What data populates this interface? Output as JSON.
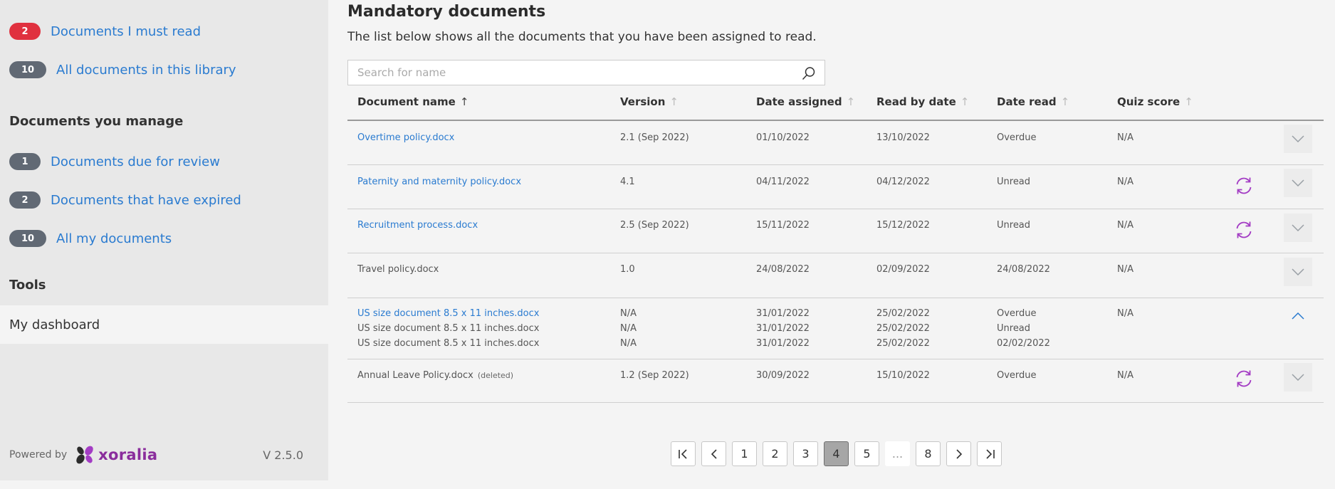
{
  "sidebar": {
    "must_read": {
      "count": "2",
      "label": "Documents I must read"
    },
    "all_library": {
      "count": "10",
      "label": "All documents in this library"
    },
    "manage_title": "Documents you manage",
    "due_review": {
      "count": "1",
      "label": "Documents due for review"
    },
    "expired": {
      "count": "2",
      "label": "Documents that have expired"
    },
    "all_mine": {
      "count": "10",
      "label": "All my documents"
    },
    "tools_title": "Tools",
    "dashboard": "My dashboard",
    "powered_by": "Powered by",
    "brand": "xoralia",
    "version": "V 2.5.0"
  },
  "main": {
    "title": "Mandatory documents",
    "description": "The list below shows all the documents that you have been assigned to read.",
    "search_placeholder": "Search for name",
    "columns": {
      "name": "Document name",
      "version": "Version",
      "date_assigned": "Date assigned",
      "read_by": "Read by date",
      "date_read": "Date read",
      "quiz": "Quiz score"
    },
    "rows": [
      {
        "name": "Overtime policy.docx",
        "version": "2.1 (Sep 2022)",
        "assigned": "01/10/2022",
        "read_by": "13/10/2022",
        "date_read": "Overdue",
        "quiz": "N/A"
      },
      {
        "name": "Paternity and maternity policy.docx",
        "version": "4.1",
        "assigned": "04/11/2022",
        "read_by": "04/12/2022",
        "date_read": "Unread",
        "quiz": "N/A"
      },
      {
        "name": "Recruitment process.docx",
        "version": "2.5 (Sep 2022)",
        "assigned": "15/11/2022",
        "read_by": "15/12/2022",
        "date_read": "Unread",
        "quiz": "N/A"
      },
      {
        "name": "Travel policy.docx",
        "version": "1.0",
        "assigned": "24/08/2022",
        "read_by": "02/09/2022",
        "date_read": "24/08/2022",
        "quiz": "N/A"
      },
      {
        "name": "US size document 8.5 x 11 inches.docx",
        "version": "N/A",
        "assigned": "31/01/2022",
        "read_by": "25/02/2022",
        "date_read": "Overdue",
        "quiz": "N/A",
        "sub": [
          {
            "name": "US size document 8.5 x 11 inches.docx",
            "version": "N/A",
            "assigned": "31/01/2022",
            "read_by": "25/02/2022",
            "date_read": "Unread"
          },
          {
            "name": "US size document 8.5 x 11 inches.docx",
            "version": "N/A",
            "assigned": "31/01/2022",
            "read_by": "25/02/2022",
            "date_read": "02/02/2022"
          }
        ]
      },
      {
        "name": "Annual Leave Policy.docx",
        "deleted": "(deleted)",
        "version": "1.2 (Sep 2022)",
        "assigned": "30/09/2022",
        "read_by": "15/10/2022",
        "date_read": "Overdue",
        "quiz": "N/A"
      }
    ]
  },
  "pagination": {
    "pages": [
      "1",
      "2",
      "3",
      "4",
      "5",
      "...",
      "8"
    ],
    "current": "4"
  },
  "colors": {
    "accent_link": "#2a7bd0",
    "badge_red": "#e0313f",
    "badge_gray": "#616974",
    "refresh_purple": "#a33cc4",
    "chevron_blue": "#2a7bd0"
  }
}
